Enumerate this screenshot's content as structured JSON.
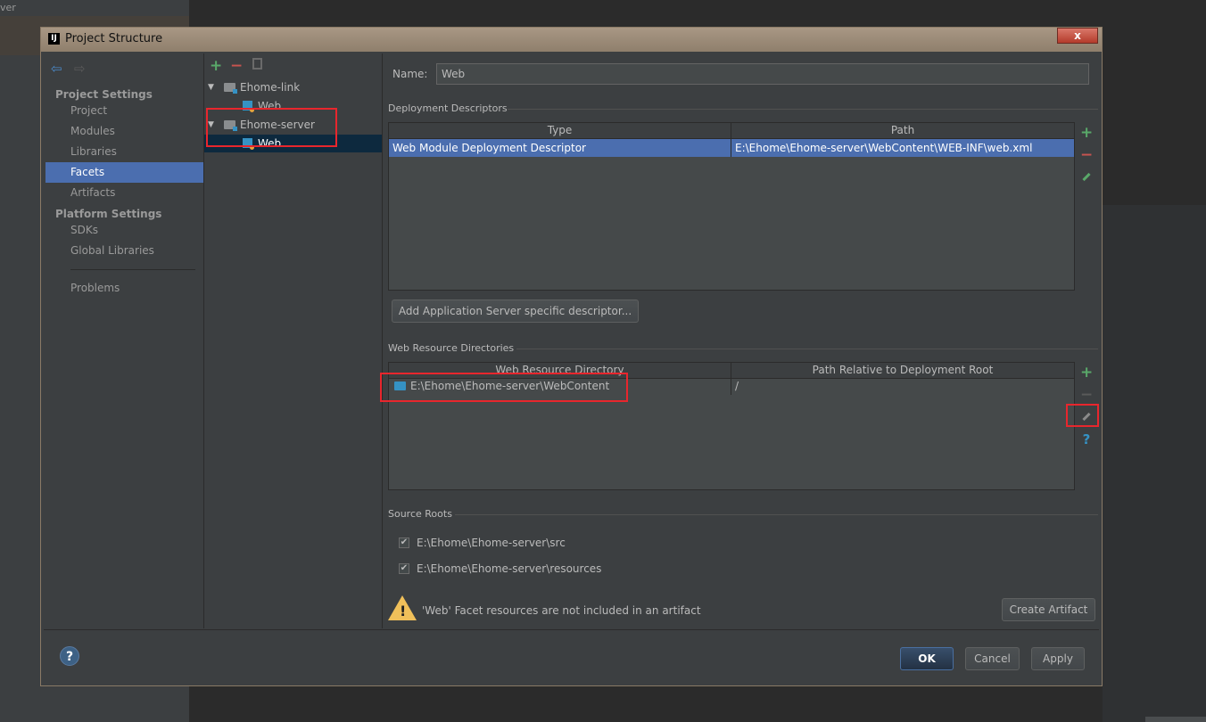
{
  "background": {
    "fragment_text": "ver"
  },
  "dialog": {
    "title": "Project Structure",
    "close_label": "x"
  },
  "nav": {
    "back_icon": "arrow-left-icon",
    "forward_icon": "arrow-right-icon",
    "section_project": "Project Settings",
    "project_items": [
      "Project",
      "Modules",
      "Libraries",
      "Facets",
      "Artifacts"
    ],
    "selected": "Facets",
    "section_platform": "Platform Settings",
    "platform_items": [
      "SDKs",
      "Global Libraries"
    ],
    "problems": "Problems"
  },
  "tree": {
    "toolbar": {
      "add": "+",
      "remove": "−"
    },
    "nodes": [
      {
        "label": "Ehome-link",
        "children": [
          "Web"
        ]
      },
      {
        "label": "Ehome-server",
        "children": [
          "Web"
        ]
      }
    ]
  },
  "main": {
    "name_label": "Name:",
    "name_value": "Web",
    "deployment": {
      "title": "Deployment Descriptors",
      "columns": [
        "Type",
        "Path"
      ],
      "rows": [
        {
          "type": "Web Module Deployment Descriptor",
          "path": "E:\\Ehome\\Ehome-server\\WebContent\\WEB-INF\\web.xml"
        }
      ],
      "add_server_button": "Add Application Server specific descriptor..."
    },
    "web_resources": {
      "title": "Web Resource Directories",
      "columns": [
        "Web Resource Directory",
        "Path Relative to Deployment Root"
      ],
      "rows": [
        {
          "directory": "E:\\Ehome\\Ehome-server\\WebContent",
          "relative": "/"
        }
      ],
      "help_mark": "?"
    },
    "source_roots": {
      "title": "Source Roots",
      "items": [
        {
          "path": "E:\\Ehome\\Ehome-server\\src",
          "checked": true
        },
        {
          "path": "E:\\Ehome\\Ehome-server\\resources",
          "checked": true
        }
      ]
    },
    "warning_text": "'Web' Facet resources are not included in an artifact",
    "create_artifact_button": "Create Artifact"
  },
  "footer": {
    "help": "?",
    "ok": "OK",
    "cancel": "Cancel",
    "apply": "Apply"
  },
  "colors": {
    "selection": "#4b6eaf",
    "add_green": "#59a869",
    "remove_red": "#c75450",
    "annotation_red": "#e8262d",
    "warning_yellow": "#f0c05a"
  }
}
